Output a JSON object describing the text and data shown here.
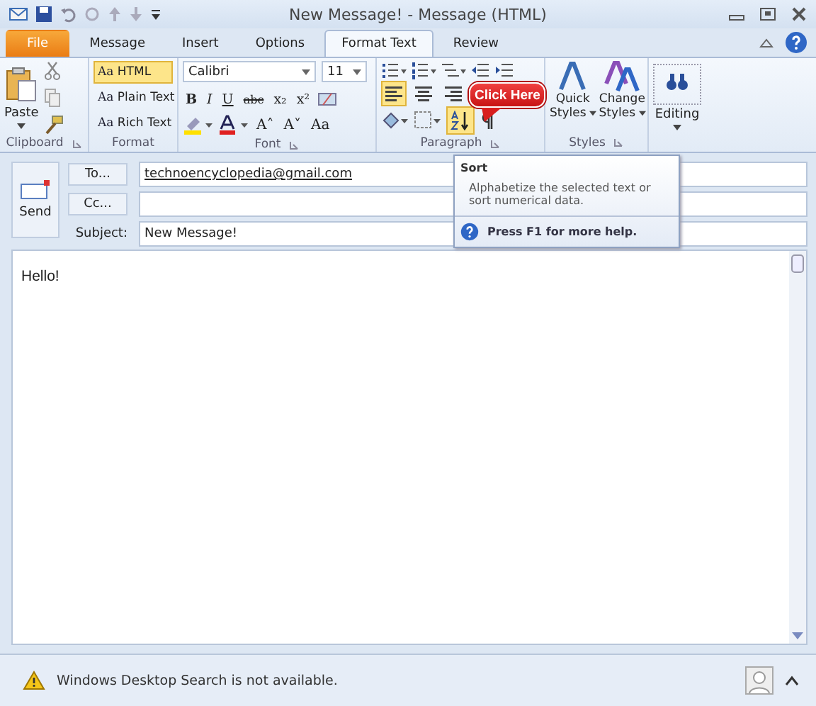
{
  "window": {
    "title": "New Message! - Message (HTML)"
  },
  "tabs": [
    {
      "label": "File",
      "kind": "file",
      "selected": false
    },
    {
      "label": "Message",
      "kind": "tab",
      "selected": false
    },
    {
      "label": "Insert",
      "kind": "tab",
      "selected": false
    },
    {
      "label": "Options",
      "kind": "tab",
      "selected": false
    },
    {
      "label": "Format Text",
      "kind": "tab",
      "selected": true
    },
    {
      "label": "Review",
      "kind": "tab",
      "selected": false
    }
  ],
  "ribbon": {
    "clipboard": {
      "label": "Clipboard",
      "paste": "Paste"
    },
    "format": {
      "label": "Format",
      "options": [
        {
          "icon": "Aa",
          "label": "HTML",
          "selected": true
        },
        {
          "icon": "Aa",
          "label": "Plain Text",
          "selected": false
        },
        {
          "icon": "Aa",
          "label": "Rich Text",
          "selected": false
        }
      ]
    },
    "font": {
      "label": "Font",
      "family": "Calibri",
      "size": "11",
      "buttons": [
        {
          "symbol": "B",
          "kind": "bold"
        },
        {
          "symbol": "I",
          "kind": "italic"
        },
        {
          "symbol": "U",
          "kind": "underline"
        },
        {
          "symbol": "abc",
          "kind": "strike"
        },
        {
          "symbol": "x₂",
          "kind": "plain"
        },
        {
          "symbol": "x²",
          "kind": "plain"
        }
      ],
      "size_buttons": [
        {
          "symbol": "A˄"
        },
        {
          "symbol": "A˅"
        },
        {
          "symbol": "Aa"
        }
      ]
    },
    "paragraph": {
      "label": "Paragraph",
      "align": [
        {
          "kind": "left",
          "selected": true
        },
        {
          "kind": "center",
          "selected": false
        },
        {
          "kind": "right",
          "selected": false
        }
      ],
      "sort_selected": true
    },
    "styles": {
      "label": "Styles",
      "quick_styles": [
        "Quick",
        "Styles"
      ],
      "change_styles": [
        "Change",
        "Styles"
      ]
    },
    "editing": {
      "label": "Editing"
    }
  },
  "callout": {
    "text": "Click Here"
  },
  "tooltip": {
    "title": "Sort",
    "description": "Alphabetize the selected text or sort numerical data.",
    "help": "Press F1 for more help."
  },
  "compose": {
    "send": "Send",
    "to_button": "To...",
    "to_value": "technoencyclopedia@gmail.com",
    "cc_button": "Cc...",
    "subject_label": "Subject:",
    "subject_value": "New Message!"
  },
  "body": {
    "text": "Hello!"
  },
  "status_bar": {
    "message": "Windows Desktop Search is not available."
  }
}
